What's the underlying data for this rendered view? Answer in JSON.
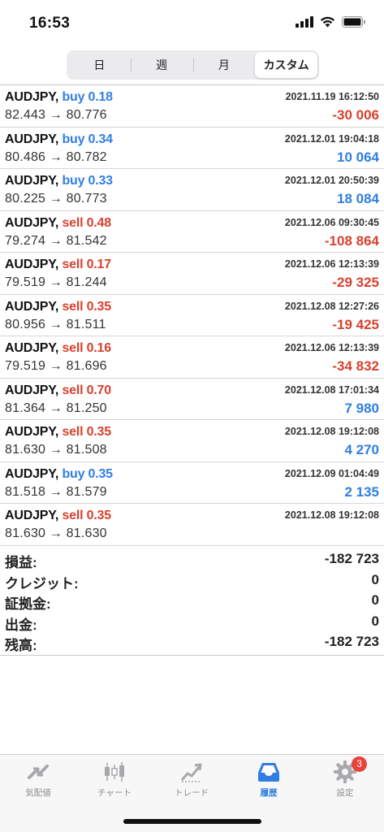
{
  "status": {
    "time": "16:53"
  },
  "period_tabs": [
    {
      "label": "日"
    },
    {
      "label": "週"
    },
    {
      "label": "月"
    },
    {
      "label": "カスタム",
      "active": true
    }
  ],
  "deals": [
    {
      "symbol": "AUDJPY,",
      "side": "buy",
      "action": "buy 0.18",
      "prices": "82.443 → 80.776",
      "datetime": "2021.11.19 16:12:50",
      "profit": "-30 006"
    },
    {
      "symbol": "AUDJPY,",
      "side": "buy",
      "action": "buy 0.34",
      "prices": "80.486 → 80.782",
      "datetime": "2021.12.01 19:04:18",
      "profit": "10 064"
    },
    {
      "symbol": "AUDJPY,",
      "side": "buy",
      "action": "buy 0.33",
      "prices": "80.225 → 80.773",
      "datetime": "2021.12.01 20:50:39",
      "profit": "18 084"
    },
    {
      "symbol": "AUDJPY,",
      "side": "sell",
      "action": "sell 0.48",
      "prices": "79.274 → 81.542",
      "datetime": "2021.12.06 09:30:45",
      "profit": "-108 864"
    },
    {
      "symbol": "AUDJPY,",
      "side": "sell",
      "action": "sell 0.17",
      "prices": "79.519 → 81.244",
      "datetime": "2021.12.06 12:13:39",
      "profit": "-29 325"
    },
    {
      "symbol": "AUDJPY,",
      "side": "sell",
      "action": "sell 0.35",
      "prices": "80.956 → 81.511",
      "datetime": "2021.12.08 12:27:26",
      "profit": "-19 425"
    },
    {
      "symbol": "AUDJPY,",
      "side": "sell",
      "action": "sell 0.16",
      "prices": "79.519 → 81.696",
      "datetime": "2021.12.06 12:13:39",
      "profit": "-34 832"
    },
    {
      "symbol": "AUDJPY,",
      "side": "sell",
      "action": "sell 0.70",
      "prices": "81.364 → 81.250",
      "datetime": "2021.12.08 17:01:34",
      "profit": "7 980"
    },
    {
      "symbol": "AUDJPY,",
      "side": "sell",
      "action": "sell 0.35",
      "prices": "81.630 → 81.508",
      "datetime": "2021.12.08 19:12:08",
      "profit": "4 270"
    },
    {
      "symbol": "AUDJPY,",
      "side": "buy",
      "action": "buy 0.35",
      "prices": "81.518 → 81.579",
      "datetime": "2021.12.09 01:04:49",
      "profit": "2 135"
    },
    {
      "symbol": "AUDJPY,",
      "side": "sell",
      "action": "sell 0.35",
      "prices": "81.630 → 81.630",
      "datetime": "2021.12.08 19:12:08",
      "profit": ""
    }
  ],
  "summary": [
    {
      "label": "損益:",
      "value": "-182 723"
    },
    {
      "label": "クレジット:",
      "value": "0"
    },
    {
      "label": "証拠金:",
      "value": "0"
    },
    {
      "label": "出金:",
      "value": "0"
    },
    {
      "label": "残高:",
      "value": "-182 723"
    }
  ],
  "tabbar": [
    {
      "label": "気配値",
      "icon": "quotes-arrows-icon"
    },
    {
      "label": "チャート",
      "icon": "candlestick-chart-icon"
    },
    {
      "label": "トレード",
      "icon": "trade-chart-icon"
    },
    {
      "label": "履歴",
      "icon": "history-inbox-icon",
      "active": true
    },
    {
      "label": "設定",
      "icon": "gear-icon",
      "badge": "3"
    }
  ],
  "colors": {
    "buy": "#2f7ee3",
    "sell": "#d9412f",
    "active_tab": "#2f7ee3",
    "badge": "#e8423a"
  }
}
